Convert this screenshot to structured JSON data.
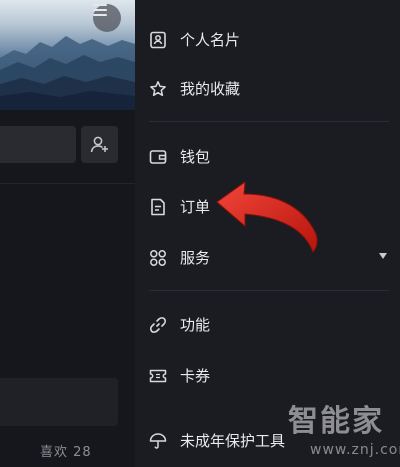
{
  "drawer": {
    "items": [
      {
        "label": "个人名片",
        "icon": "id-card-icon"
      },
      {
        "label": "我的收藏",
        "icon": "star-icon"
      },
      {
        "label": "钱包",
        "icon": "wallet-icon"
      },
      {
        "label": "订单",
        "icon": "order-icon"
      },
      {
        "label": "服务",
        "icon": "services-grid-icon"
      },
      {
        "label": "功能",
        "icon": "link-icon"
      },
      {
        "label": "卡券",
        "icon": "ticket-icon"
      },
      {
        "label": "未成年保护工具",
        "icon": "umbrella-icon"
      }
    ]
  },
  "profile": {
    "likes_text": "喜欢 28"
  },
  "watermark": {
    "title": "智能家",
    "url": "www.znj.com"
  },
  "colors": {
    "drawer_bg": "#1b1c21",
    "text": "#e9eaee",
    "arrow": "#e0281c"
  }
}
